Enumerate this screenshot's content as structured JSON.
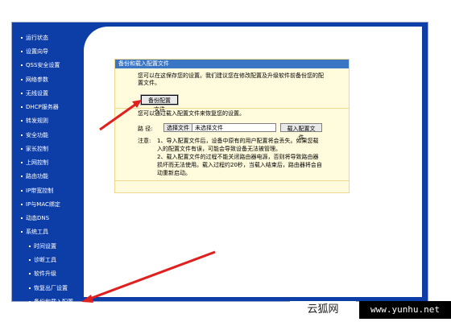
{
  "sidebar": {
    "items": [
      {
        "label": "运行状态"
      },
      {
        "label": "设置向导"
      },
      {
        "label": "QSS安全设置"
      },
      {
        "label": "网络参数"
      },
      {
        "label": "无线设置"
      },
      {
        "label": "DHCP服务器"
      },
      {
        "label": "转发规则"
      },
      {
        "label": "安全功能"
      },
      {
        "label": "家长控制"
      },
      {
        "label": "上网控制"
      },
      {
        "label": "路由功能"
      },
      {
        "label": "IP带宽控制"
      },
      {
        "label": "IP与MAC绑定"
      },
      {
        "label": "动态DNS"
      },
      {
        "label": "系统工具"
      }
    ],
    "sub_items": [
      {
        "label": "时间设置"
      },
      {
        "label": "诊断工具"
      },
      {
        "label": "软件升级"
      },
      {
        "label": "恢复出厂设置"
      },
      {
        "label": "备份和载入配置"
      }
    ]
  },
  "panel": {
    "title": "备份和载入配置文件",
    "description": "您可以在这保存您的设置。我们建议您在修改配置及升级软件前备份您的配置文件。",
    "backup_button": "备份配置文件",
    "restore_description": "您可以通过载入配置文件来恢复您的设置。",
    "path_label": "路 径:",
    "choose_file_button": "选择文件",
    "no_file_text": "未选择文件",
    "load_button": "载入配置文件",
    "note_label": "注意:",
    "note_1": "1、导入配置文件后，设备中原有的用户配置将会丢失。如果您载入的配置文件有误，可能会导致设备无法被管理。",
    "note_2": "2、载入配置文件的过程不能关闭路由器电源，否则将导致路由器损坏而无法使用。载入过程约20秒，当载入结束后，路由器将会自动重新启动。"
  },
  "watermark": {
    "site_name": "云狐网",
    "url": "www.yunhu.net"
  },
  "colors": {
    "sidebar_bg": "#0d3ea8",
    "panel_title_bg": "#3a76c4",
    "panel_bg": "#fffbdc",
    "arrow": "#e0201e"
  }
}
